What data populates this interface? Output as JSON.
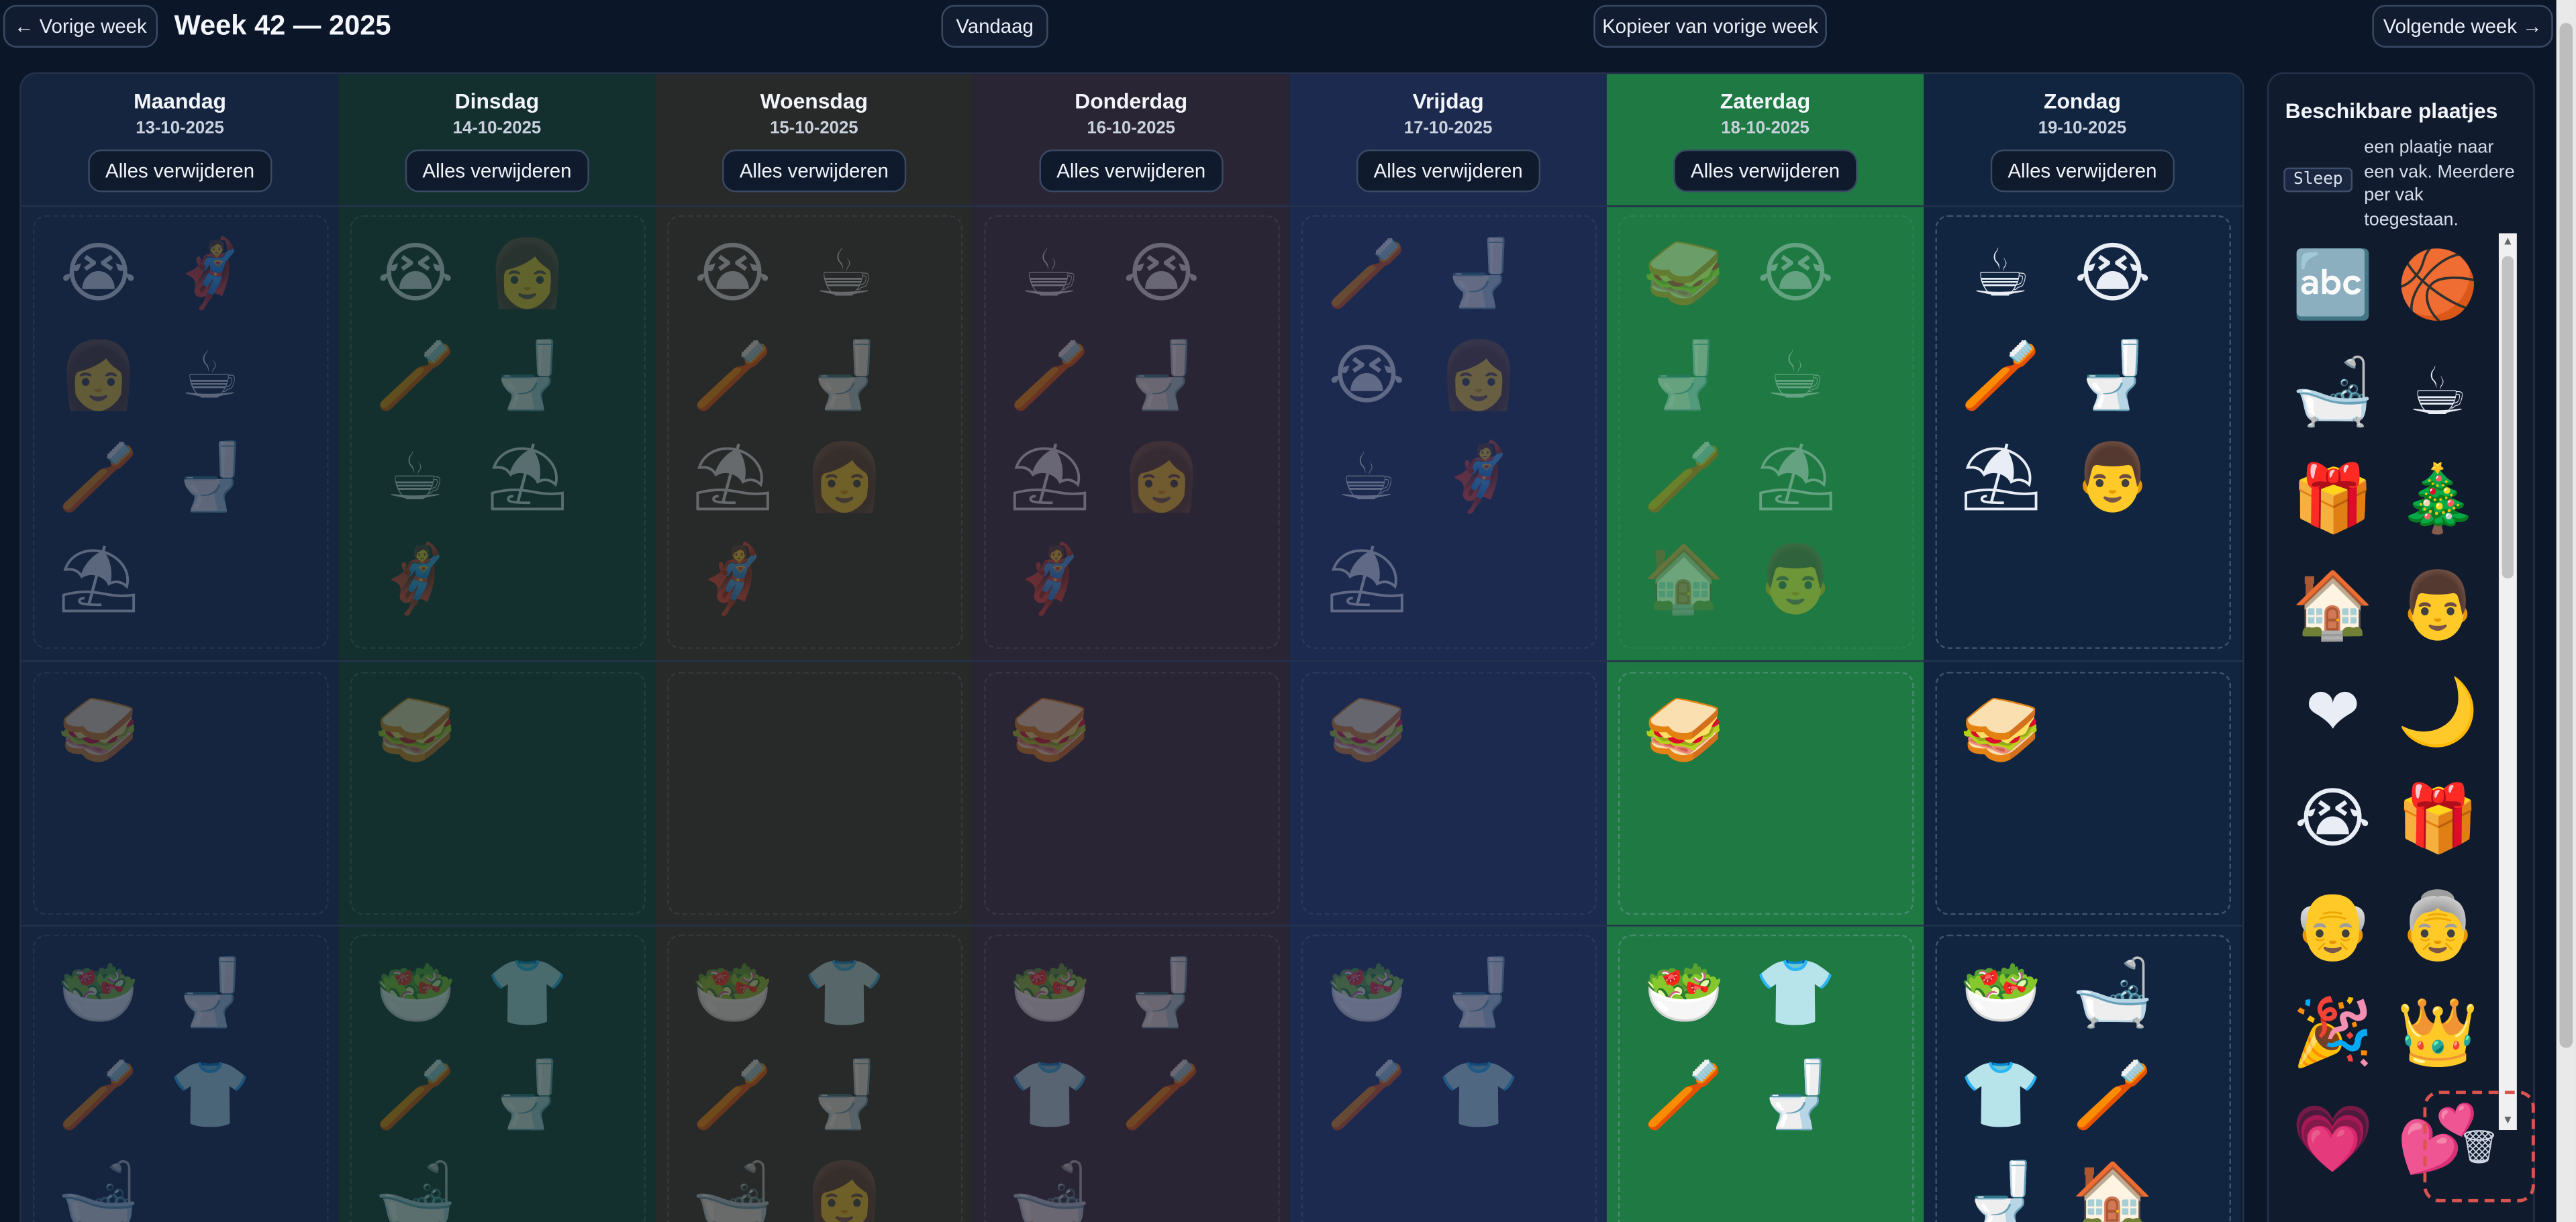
{
  "header": {
    "prev_week": "← Vorige week",
    "title": "Week 42 — 2025",
    "today": "Vandaag",
    "copy_prev": "Kopieer van vorige week",
    "next_week": "Volgende week →"
  },
  "clear_label": "Alles verwijderen",
  "days": [
    {
      "name": "Maandag",
      "date": "13-10-2025",
      "bg": "#152540",
      "faded": true,
      "slots": [
        [
          "crying-child",
          "person-cape",
          "woman",
          "breakfast",
          "toothbrush",
          "toilet",
          "beach"
        ],
        [
          "snack-clock"
        ],
        [
          "salad-plate",
          "toilet",
          "toothbrush",
          "pajamas",
          "bathtub"
        ]
      ]
    },
    {
      "name": "Dinsdag",
      "date": "14-10-2025",
      "bg": "#13302f",
      "faded": true,
      "slots": [
        [
          "crying-child",
          "woman",
          "toothbrush",
          "toilet",
          "breakfast",
          "beach",
          "person-cape"
        ],
        [
          "snack-clock"
        ],
        [
          "salad-plate",
          "pajamas",
          "toothbrush",
          "toilet",
          "bathtub"
        ]
      ]
    },
    {
      "name": "Woensdag",
      "date": "15-10-2025",
      "bg": "#282a2a",
      "faded": true,
      "slots": [
        [
          "crying-child",
          "breakfast",
          "toothbrush",
          "toilet",
          "beach",
          "woman",
          "person-cape"
        ],
        [],
        [
          "salad-plate",
          "pajamas",
          "toothbrush",
          "toilet",
          "bathtub",
          "woman"
        ]
      ]
    },
    {
      "name": "Donderdag",
      "date": "16-10-2025",
      "bg": "#2a2535",
      "faded": true,
      "slots": [
        [
          "breakfast",
          "crying-child",
          "toothbrush",
          "toilet",
          "beach",
          "woman",
          "person-cape"
        ],
        [
          "snack-clock"
        ],
        [
          "salad-plate",
          "toilet",
          "pajamas",
          "toothbrush",
          "bathtub"
        ]
      ]
    },
    {
      "name": "Vrijdag",
      "date": "17-10-2025",
      "bg": "#1d2a4f",
      "faded": true,
      "slots": [
        [
          "toothbrush",
          "toilet",
          "crying-child",
          "woman",
          "breakfast",
          "person-cape",
          "beach"
        ],
        [
          "snack-clock"
        ],
        [
          "salad-plate",
          "toilet",
          "toothbrush",
          "pajamas"
        ]
      ]
    },
    {
      "name": "Zaterdag",
      "date": "18-10-2025",
      "bg": "#1e7a42",
      "faded": false,
      "partly_faded": true,
      "slots": [
        [
          "snack-clock",
          "crying-child",
          "toilet",
          "breakfast",
          "toothbrush",
          "beach",
          "house",
          "man"
        ],
        [
          "snack-clock"
        ],
        [
          "salad-plate",
          "pajamas",
          "toothbrush",
          "toilet"
        ]
      ]
    },
    {
      "name": "Zondag",
      "date": "19-10-2025",
      "bg": "#112540",
      "faded": false,
      "slots": [
        [
          "breakfast",
          "crying-child",
          "toothbrush",
          "toilet",
          "beach",
          "man"
        ],
        [
          "snack-clock"
        ],
        [
          "salad-plate",
          "bathtub",
          "pajamas",
          "toothbrush",
          "toilet",
          "house"
        ]
      ]
    }
  ],
  "sidebar": {
    "title": "Beschikbare plaatjes",
    "sleep_chip": "Sleep",
    "help": "een plaatje naar een vak. Meerdere per vak toegestaan.",
    "gallery": [
      "alphabet-board",
      "sports-balls",
      "bathtub",
      "breakfast",
      "gift-person",
      "christmas-tree",
      "house",
      "man",
      "dad-heart",
      "night-sky",
      "crying-child",
      "gifts",
      "grandpa",
      "grandma",
      "birthday",
      "king",
      "mom-heart",
      "hearts"
    ]
  },
  "icons": {
    "crying-child": "😭",
    "person-cape": "🦸",
    "woman": "👩",
    "breakfast": "☕",
    "toothbrush": "🪥",
    "toilet": "🚽",
    "beach": "⛱",
    "snack-clock": "🥪",
    "salad-plate": "🥗",
    "pajamas": "👕",
    "bathtub": "🛁",
    "house": "🏠",
    "man": "👨",
    "alphabet-board": "🔤",
    "sports-balls": "🏀",
    "gift-person": "🎁",
    "christmas-tree": "🎄",
    "dad-heart": "❤",
    "night-sky": "🌙",
    "gifts": "🎁",
    "grandpa": "👴",
    "grandma": "👵",
    "birthday": "🎉",
    "king": "👑",
    "mom-heart": "💗",
    "hearts": "💕"
  },
  "trash_icon": "🗑"
}
